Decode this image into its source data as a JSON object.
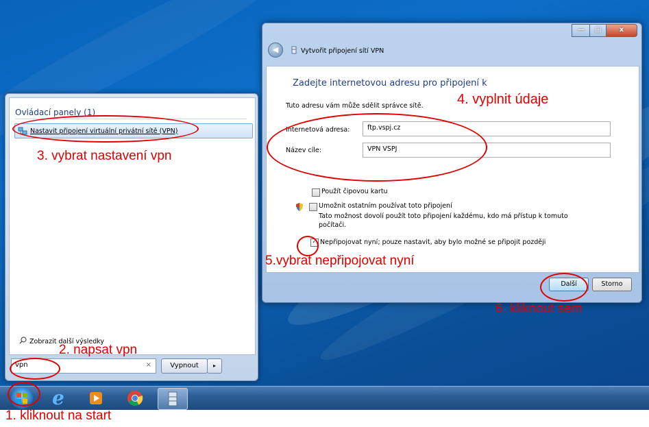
{
  "start_menu": {
    "section_header": "Ovládací panely (1)",
    "result_item": "Nastavit připojení virtuální privátní sítě (VPN)",
    "more_results": "Zobrazit další výsledky",
    "search_value": "vpn",
    "clear_symbol": "×",
    "shutdown_label": "Vypnout",
    "shutdown_arrow": "▸"
  },
  "dialog": {
    "title": "Vytvořit připojení sítí VPN",
    "heading": "Zadejte internetovou adresu pro připojení k",
    "hint": "Tuto adresu vám může sdělit správce sítě.",
    "internet_address_label": "Internetová adresa:",
    "internet_address_value": "ftp.vspj.cz",
    "destination_name_label": "Název cíle:",
    "destination_name_value": "VPN VSPJ",
    "smartcard_label": "Použít čipovou kartu",
    "allow_others_label": "Umožnit ostatním používat toto připojení",
    "allow_others_desc": "Tato možnost dovolí použít toto připojení každému, kdo má přístup k tomuto počítači.",
    "dont_connect_label": "Nepřipojovat nyní; pouze nastavit, aby bylo možné se připojit později",
    "dont_connect_checked": true,
    "next_button": "Další",
    "cancel_button": "Storno",
    "min_symbol": "—",
    "max_symbol": "□",
    "close_symbol": "x",
    "back_symbol": "◀"
  },
  "taskbar": {
    "icons": [
      "start-orb-icon",
      "internet-explorer-icon",
      "media-player-icon",
      "chrome-icon",
      "file-cabinet-icon"
    ]
  },
  "annotations": {
    "step1": "1. kliknout na start",
    "step2": "2. napsat vpn",
    "step3": "3. vybrat nastavení vpn",
    "step4": "4. vyplnit údaje",
    "step5": "5.vybrat nepřipojovat nyní",
    "step6": "6. kliknout sem",
    "color": "#e00000"
  }
}
